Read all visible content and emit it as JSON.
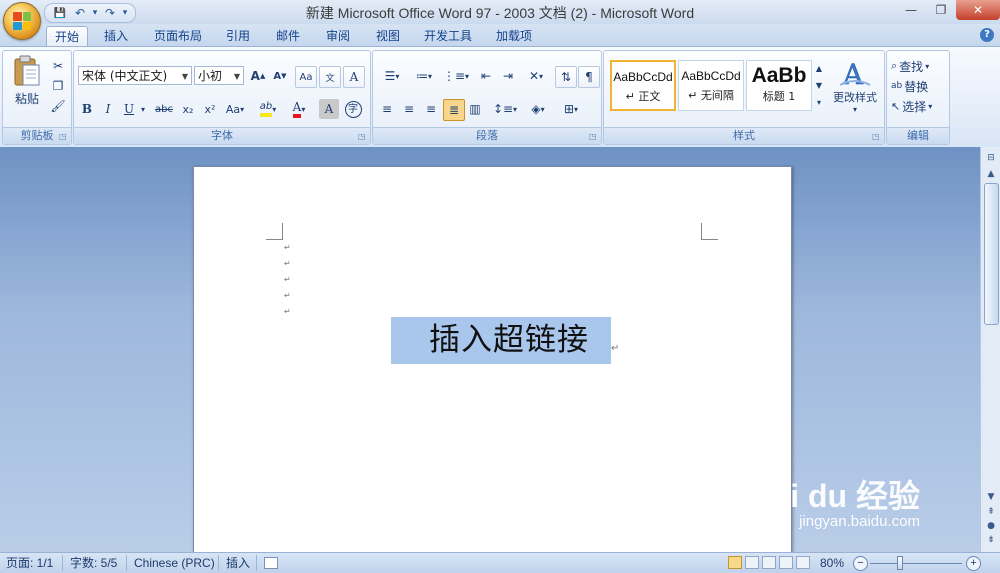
{
  "window": {
    "title": "新建 Microsoft Office Word 97 - 2003 文档 (2) - Microsoft Word",
    "controls": {
      "minimize": "—",
      "maximize": "❐",
      "close": "✕"
    }
  },
  "qat": {
    "save": "💾",
    "undo": "↶",
    "undo_drop": "▾",
    "redo": "↷",
    "customize": "▾"
  },
  "tabs": [
    {
      "label": "开始",
      "active": true
    },
    {
      "label": "插入"
    },
    {
      "label": "页面布局"
    },
    {
      "label": "引用"
    },
    {
      "label": "邮件"
    },
    {
      "label": "审阅"
    },
    {
      "label": "视图"
    },
    {
      "label": "开发工具"
    },
    {
      "label": "加载项"
    }
  ],
  "help": "?",
  "ribbon": {
    "clipboard": {
      "label": "剪贴板",
      "paste": "粘贴"
    },
    "font": {
      "label": "字体",
      "font_name": "宋体 (中文正文)",
      "font_size": "小初",
      "grow": "A",
      "shrink": "A",
      "bold": "B",
      "italic": "I",
      "underline": "U",
      "strike": "abc",
      "subscript": "x₂",
      "superscript": "x²",
      "change_case": "Aa",
      "highlight": "ab",
      "font_color": "A",
      "shading": "A",
      "phonetic": "文",
      "border": "A",
      "enclose": "字"
    },
    "paragraph": {
      "label": "段落"
    },
    "styles": {
      "label": "样式",
      "tiles": [
        {
          "sample": "AaBbCcDd",
          "name": "↵ 正文",
          "selected": true
        },
        {
          "sample": "AaBbCcDd",
          "name": "↵ 无间隔"
        },
        {
          "sample": "AaBb",
          "name": "标题 1"
        }
      ],
      "change_styles": "更改样式"
    },
    "editing": {
      "label": "编辑",
      "find": "查找",
      "replace": "替换",
      "select": "选择"
    }
  },
  "document": {
    "text": "插入超链接",
    "para_mark": "↵",
    "small_marks": [
      "↵",
      "↵",
      "↵",
      "↵",
      "↵"
    ]
  },
  "watermark": {
    "brand": "Bai du 经验",
    "url": "jingyan.baidu.com"
  },
  "status": {
    "page": "页面: 1/1",
    "words": "字数: 5/5",
    "language": "Chinese (PRC)",
    "mode": "插入",
    "zoom": "80%",
    "zoom_fraction": 0.33
  },
  "colors": {
    "highlight": "#f7e61b",
    "font_color": "#e0161d",
    "selection": "#a9c6ec"
  }
}
